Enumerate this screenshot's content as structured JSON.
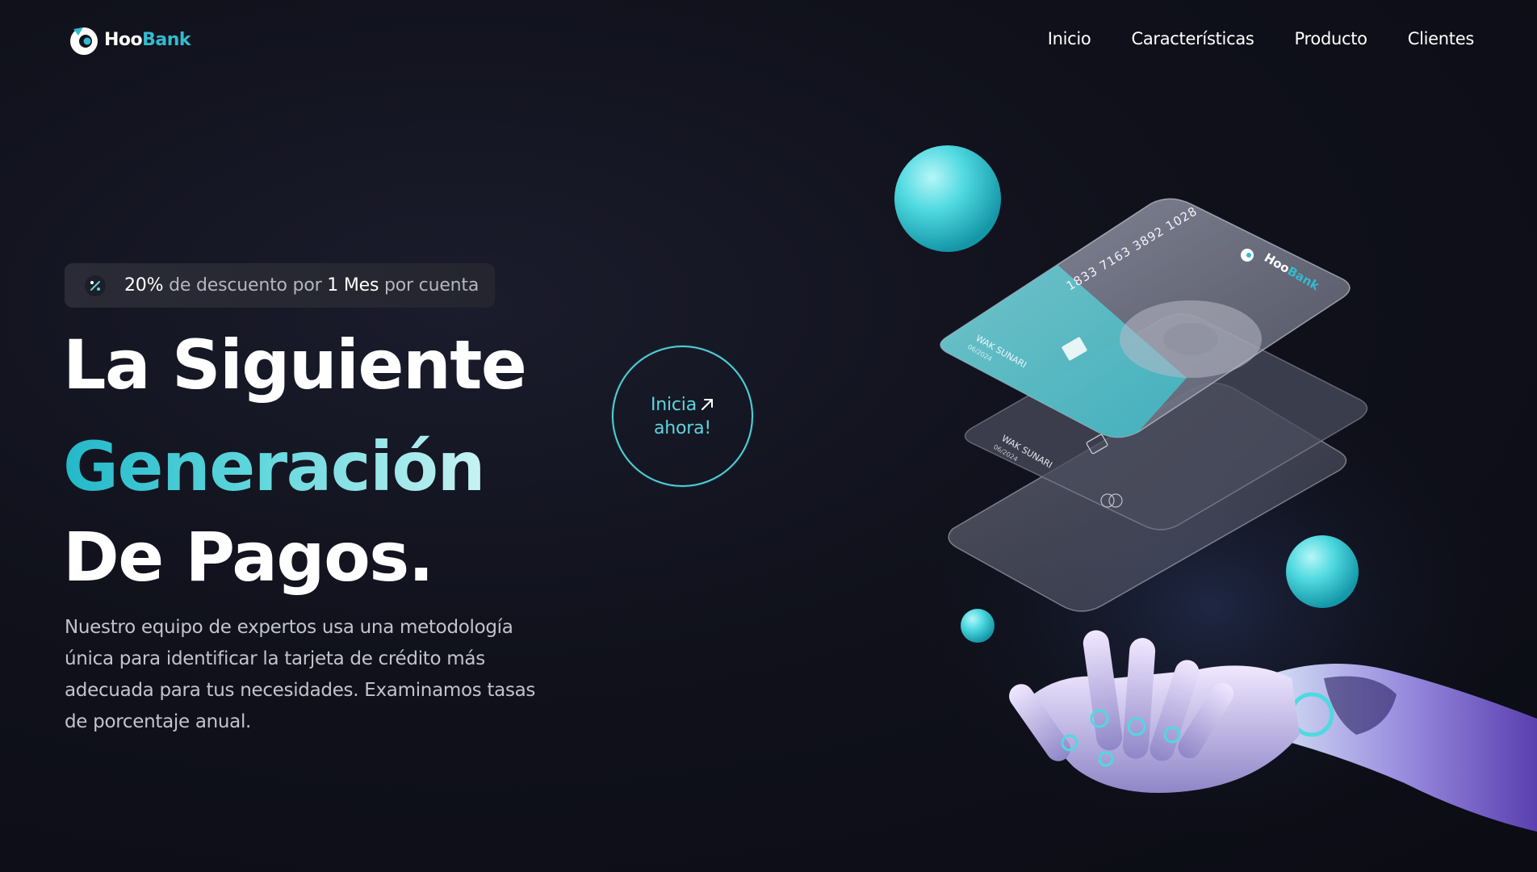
{
  "brand": {
    "hoo": "Hoo",
    "bank": "Bank"
  },
  "nav": {
    "items": [
      {
        "label": "Inicio"
      },
      {
        "label": "Características"
      },
      {
        "label": "Producto"
      },
      {
        "label": "Clientes"
      }
    ]
  },
  "promo": {
    "percent": "20%",
    "text1": " de descuento por ",
    "period": "1 Mes",
    "text2": " por cuenta"
  },
  "hero": {
    "line1": "La Siguiente",
    "line2": "Generación",
    "line3": "De Pagos.",
    "description": "Nuestro equipo de expertos usa una metodología única para identificar la tarjeta de crédito más adecuada para tus necesidades. Examinamos tasas de porcentaje anual."
  },
  "cta": {
    "line1": "Inicia",
    "line2": "ahora!"
  },
  "cards": {
    "number": "1833 7163 3892 1028",
    "holder": "WAK SUNARI",
    "expiry": "06/2024",
    "brand_hoo": "Hoo",
    "brand_bank": "Bank"
  },
  "colors": {
    "accent": "#33bbcf",
    "background": "#10111b",
    "text_muted": "#c3c3cb"
  }
}
